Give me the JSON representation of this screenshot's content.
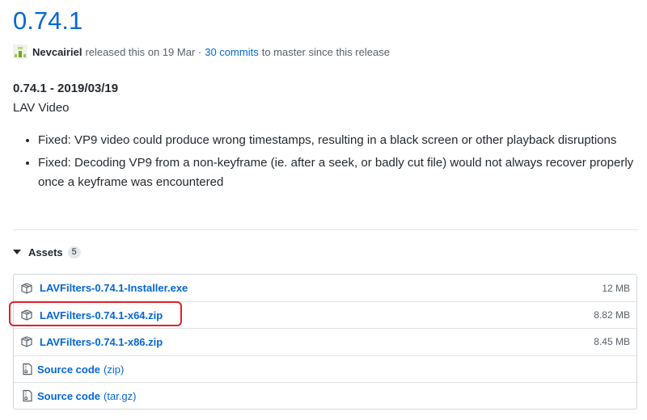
{
  "release": {
    "title": "0.74.1",
    "author": "Nevcairiel",
    "released_text": "released this on 19 Mar ·",
    "commits_link": "30 commits",
    "commits_suffix": "to master since this release"
  },
  "notes": {
    "heading": "0.74.1 - 2019/03/19",
    "subtitle": "LAV Video",
    "items": [
      "Fixed: VP9 video could produce wrong timestamps, resulting in a black screen or other playback disruptions",
      "Fixed: Decoding VP9 from a non-keyframe (ie. after a seek, or badly cut file) would not always recover properly once a keyframe was encountered"
    ]
  },
  "assets": {
    "label": "Assets",
    "count": "5",
    "files": [
      {
        "name": "LAVFilters-0.74.1-Installer.exe",
        "size": "12 MB",
        "icon": "package-icon"
      },
      {
        "name": "LAVFilters-0.74.1-x64.zip",
        "size": "8.82 MB",
        "icon": "package-icon",
        "highlighted": true
      },
      {
        "name": "LAVFilters-0.74.1-x86.zip",
        "size": "8.45 MB",
        "icon": "package-icon"
      }
    ],
    "sources": [
      {
        "label": "Source code",
        "format": "(zip)",
        "icon": "file-zip-icon"
      },
      {
        "label": "Source code",
        "format": "(tar.gz)",
        "icon": "file-zip-icon"
      }
    ]
  },
  "colors": {
    "link": "#0366d6",
    "text": "#24292e",
    "muted": "#586069",
    "highlight": "#e0202a",
    "border": "#d1d5da"
  }
}
